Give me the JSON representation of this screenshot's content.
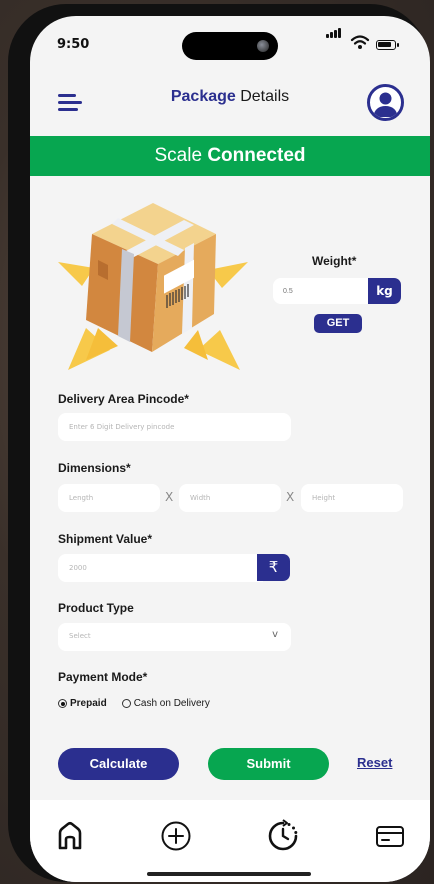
{
  "status_bar": {
    "time": "9:50"
  },
  "header": {
    "title_bold": "Package",
    "title_rest": " Details"
  },
  "banner": {
    "prefix": "Scale ",
    "bold": "Connected"
  },
  "weight": {
    "label": "Weight*",
    "placeholder": "0.5",
    "unit": "kg",
    "get_label": "GET"
  },
  "pincode": {
    "label": "Delivery Area Pincode*",
    "placeholder": "Enter 6 Digit Delivery pincode"
  },
  "dimensions": {
    "label": "Dimensions*",
    "length_placeholder": "Length",
    "width_placeholder": "Width",
    "height_placeholder": "Height",
    "separator": "X"
  },
  "shipment": {
    "label": "Shipment Value*",
    "placeholder": "2000",
    "currency_symbol": "₹"
  },
  "product_type": {
    "label": "Product Type",
    "placeholder": "Select",
    "chevron": "v"
  },
  "payment": {
    "label": "Payment Mode*",
    "options": [
      "Prepaid",
      "Cash on Delivery"
    ],
    "selected": "Prepaid"
  },
  "actions": {
    "calculate": "Calculate",
    "submit": "Submit",
    "reset": "Reset"
  },
  "tabbar": {
    "icons": [
      "home-icon",
      "add-circle-icon",
      "history-icon",
      "card-icon"
    ]
  },
  "colors": {
    "primary": "#2b2f8f",
    "success": "#07a650",
    "background": "#f4f4f4"
  }
}
